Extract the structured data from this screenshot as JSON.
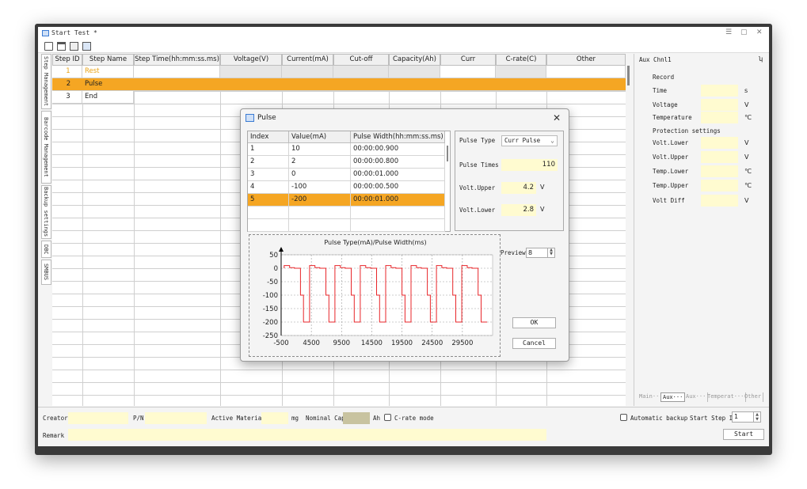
{
  "window": {
    "title": "Start Test *",
    "controls": [
      "☰",
      "▢",
      "✕"
    ]
  },
  "side_tabs": [
    "Step Management",
    "Barcode Management",
    "Backup settings",
    "DBC",
    "SMBUS"
  ],
  "steps_table": {
    "columns": [
      "Step ID",
      "Step Name",
      "Step Time(hh:mm:ss.ms)",
      "Voltage(V)",
      "Current(mA)",
      "Cut-off Curr(mA)",
      "Capacity(Ah)",
      "Curr Range(mA)",
      "C-rate(C)",
      "Other"
    ],
    "rows": [
      {
        "id": "1",
        "name": "Rest"
      },
      {
        "id": "2",
        "name": "Pulse"
      },
      {
        "id": "3",
        "name": "End"
      }
    ]
  },
  "aux_panel": {
    "title": "Aux Chnl1",
    "pin": "ʮ",
    "record_label": "Record",
    "fields": [
      {
        "label": "Time",
        "unit": "s"
      },
      {
        "label": "Voltage",
        "unit": "V"
      },
      {
        "label": "Temperature",
        "unit": "℃"
      }
    ],
    "protection_label": "Protection settings",
    "protection_fields": [
      {
        "label": "Volt.Lower",
        "unit": "V"
      },
      {
        "label": "Volt.Upper",
        "unit": "V"
      },
      {
        "label": "Temp.Lower",
        "unit": "℃"
      },
      {
        "label": "Temp.Upper",
        "unit": "℃"
      },
      {
        "label": "Volt Diff",
        "unit": "V"
      }
    ],
    "tabs": [
      "Main···",
      "Aux···",
      "Aux···",
      "Temperat···",
      "Other"
    ],
    "active_tab": 1
  },
  "bottom": {
    "creator_label": "Creator",
    "pn_label": "P/N",
    "active_material_label": "Active Material",
    "mg_unit": "mg",
    "nominal_cap_label": "Nominal Cap",
    "ah_unit": "Ah",
    "crate_mode_label": "C-rate mode",
    "remark_label": "Remark",
    "auto_backup_label": "Automatic backup",
    "start_step_label": "Start Step ID",
    "start_step_value": "1",
    "start_button": "Start"
  },
  "dialog": {
    "title": "Pulse",
    "close": "✕",
    "pulse_table": {
      "columns": [
        "Index",
        "Value(mA)",
        "Pulse Width(hh:mm:ss.ms)"
      ],
      "rows": [
        {
          "index": "1",
          "value": "10",
          "width": "00:00:00.900"
        },
        {
          "index": "2",
          "value": "2",
          "width": "00:00:00.800"
        },
        {
          "index": "3",
          "value": "0",
          "width": "00:00:01.000"
        },
        {
          "index": "4",
          "value": "-100",
          "width": "00:00:00.500"
        },
        {
          "index": "5",
          "value": "-200",
          "width": "00:00:01.000"
        }
      ],
      "selected_row": 4
    },
    "params": {
      "pulse_type_label": "Pulse Type",
      "pulse_type_value": "Curr Pulse",
      "pulse_times_label": "Pulse Times",
      "pulse_times_value": "110",
      "volt_upper_label": "Volt.Upper",
      "volt_upper_value": "4.2",
      "volt_upper_unit": "V",
      "volt_lower_label": "Volt.Lower",
      "volt_lower_value": "2.8",
      "volt_lower_unit": "V"
    },
    "preview_label": "Preview",
    "preview_value": "8",
    "ok_button": "OK",
    "cancel_button": "Cancel"
  },
  "colors": {
    "selected_row": "#f5a623",
    "rest_text": "#e8a317",
    "input_yellow": "#fffbd0",
    "pulse_line": "#e8262a",
    "nominal_cap_box": "#c8c3a0"
  },
  "chart_data": {
    "type": "line",
    "title": "Pulse Type(mA)/Pulse Width(ms)",
    "xlabel": "",
    "ylabel": "",
    "xlim": [
      -500,
      34500
    ],
    "ylim": [
      -250,
      50
    ],
    "xticks": [
      -500,
      4500,
      9500,
      14500,
      19500,
      24500,
      29500
    ],
    "yticks": [
      50,
      0,
      -50,
      -100,
      -150,
      -200,
      -250
    ],
    "grid": true,
    "pulse_sequence_mA": [
      10,
      2,
      0,
      -100,
      -200
    ],
    "pulse_width_ms": [
      900,
      800,
      1000,
      500,
      1000
    ],
    "repetitions": 8
  }
}
